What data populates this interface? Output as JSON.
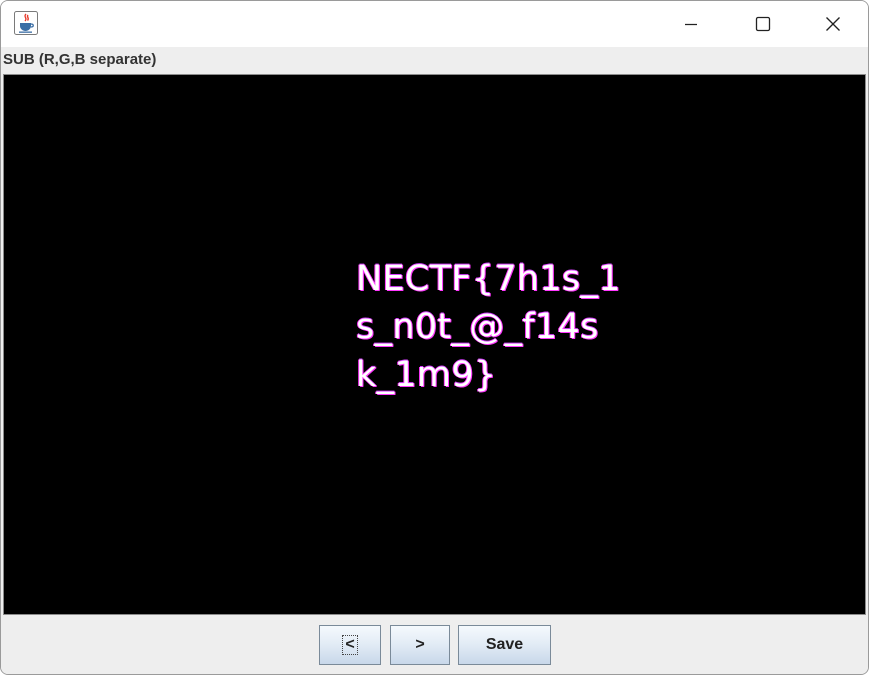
{
  "window": {
    "app_icon": "java-coffee-icon"
  },
  "panel": {
    "label": "SUB (R,G,B separate)"
  },
  "image": {
    "lines": [
      "NECTF{7h1s_1",
      "s_n0t_@_f14s",
      "k_1m9}"
    ],
    "background": "#000000",
    "text_color": "#ffffff",
    "fringe_color": "#ff38ff"
  },
  "buttons": {
    "prev_label": "<",
    "next_label": ">",
    "save_label": "Save"
  }
}
